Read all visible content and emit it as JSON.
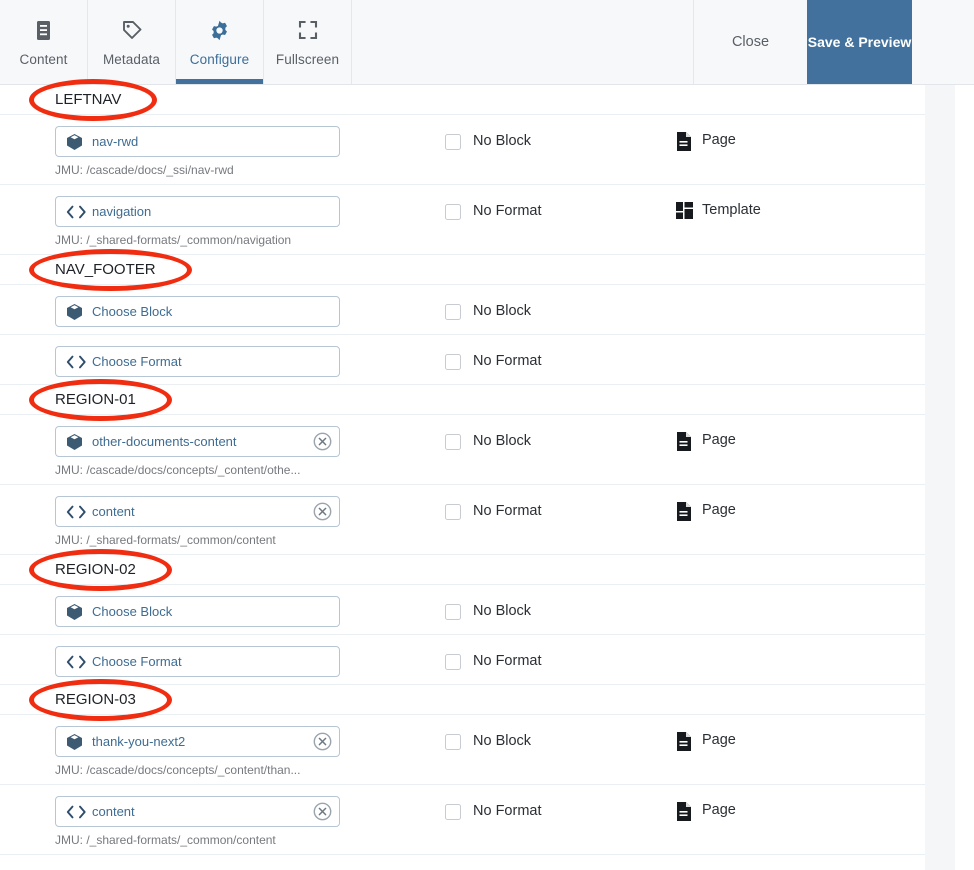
{
  "toolbar": {
    "tabs": [
      {
        "label": "Content",
        "icon": "document-lines-icon",
        "active": false
      },
      {
        "label": "Metadata",
        "icon": "tag-icon",
        "active": false
      },
      {
        "label": "Configure",
        "icon": "gear-icon",
        "active": true
      },
      {
        "label": "Fullscreen",
        "icon": "expand-icon",
        "active": false
      }
    ],
    "close_label": "Close",
    "save_label": "Save & Preview",
    "kebab_icon": "more-vertical-icon",
    "accent_color": "#41719c"
  },
  "labels": {
    "no_block": "No Block",
    "no_format": "No Format",
    "choose_block": "Choose Block",
    "choose_format": "Choose Format",
    "page": "Page",
    "template": "Template"
  },
  "sections": [
    {
      "name": "LEFTNAV",
      "annotated": true,
      "rows": [
        {
          "kind": "block",
          "icon": "block-cube-icon",
          "value": "nav-rwd",
          "clearable": false,
          "path": "JMU: /cascade/docs/_ssi/nav-rwd",
          "checkbox_label": "No Block",
          "checked": false,
          "type_icon": "page-icon",
          "type_label": "Page"
        },
        {
          "kind": "format",
          "icon": "code-brackets-icon",
          "value": "navigation",
          "clearable": false,
          "path": "JMU: /_shared-formats/_common/navigation",
          "checkbox_label": "No Format",
          "checked": false,
          "type_icon": "template-icon",
          "type_label": "Template"
        }
      ]
    },
    {
      "name": "NAV_FOOTER",
      "annotated": true,
      "rows": [
        {
          "kind": "block",
          "icon": "block-cube-icon",
          "value": "Choose Block",
          "clearable": false,
          "path": "",
          "checkbox_label": "No Block",
          "checked": false,
          "type_icon": "",
          "type_label": ""
        },
        {
          "kind": "format",
          "icon": "code-brackets-icon",
          "value": "Choose Format",
          "clearable": false,
          "path": "",
          "checkbox_label": "No Format",
          "checked": false,
          "type_icon": "",
          "type_label": ""
        }
      ]
    },
    {
      "name": "REGION-01",
      "annotated": true,
      "rows": [
        {
          "kind": "block",
          "icon": "block-cube-icon",
          "value": "other-documents-content",
          "clearable": true,
          "path": "JMU: /cascade/docs/concepts/_content/othe...",
          "checkbox_label": "No Block",
          "checked": false,
          "type_icon": "page-icon",
          "type_label": "Page"
        },
        {
          "kind": "format",
          "icon": "code-brackets-icon",
          "value": "content",
          "clearable": true,
          "path": "JMU: /_shared-formats/_common/content",
          "checkbox_label": "No Format",
          "checked": false,
          "type_icon": "page-icon",
          "type_label": "Page"
        }
      ]
    },
    {
      "name": "REGION-02",
      "annotated": true,
      "rows": [
        {
          "kind": "block",
          "icon": "block-cube-icon",
          "value": "Choose Block",
          "clearable": false,
          "path": "",
          "checkbox_label": "No Block",
          "checked": false,
          "type_icon": "",
          "type_label": ""
        },
        {
          "kind": "format",
          "icon": "code-brackets-icon",
          "value": "Choose Format",
          "clearable": false,
          "path": "",
          "checkbox_label": "No Format",
          "checked": false,
          "type_icon": "",
          "type_label": ""
        }
      ]
    },
    {
      "name": "REGION-03",
      "annotated": true,
      "rows": [
        {
          "kind": "block",
          "icon": "block-cube-icon",
          "value": "thank-you-next2",
          "clearable": true,
          "path": "JMU: /cascade/docs/concepts/_content/than...",
          "checkbox_label": "No Block",
          "checked": false,
          "type_icon": "page-icon",
          "type_label": "Page"
        },
        {
          "kind": "format",
          "icon": "code-brackets-icon",
          "value": "content",
          "clearable": true,
          "path": "JMU: /_shared-formats/_common/content",
          "checkbox_label": "No Format",
          "checked": false,
          "type_icon": "page-icon",
          "type_label": "Page"
        }
      ]
    }
  ],
  "annotation_color": "#f02d10"
}
